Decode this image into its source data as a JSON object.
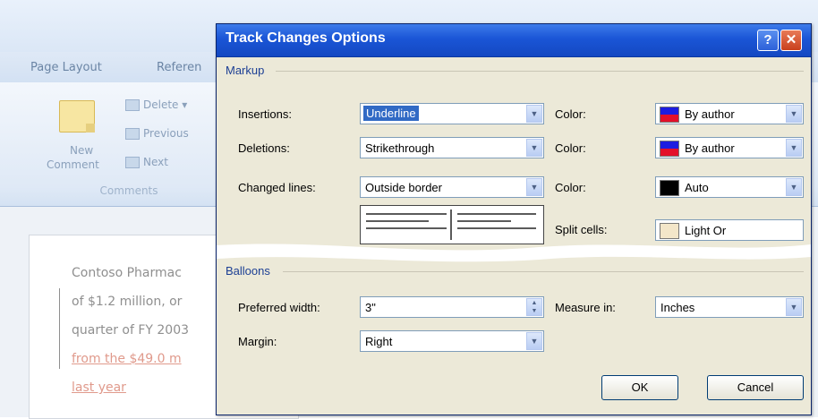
{
  "ribbon": {
    "tabs": [
      "Page Layout",
      "Referen"
    ],
    "new_comment_line1": "New",
    "new_comment_line2": "Comment",
    "delete_label": "Delete",
    "previous_label": "Previous",
    "next_label": "Next",
    "group_title": "Comments"
  },
  "document": {
    "lines": [
      "Contoso Pharmac",
      "of $1.2 million, or",
      "quarter of FY 2003",
      "from the $49.0 m",
      "last year"
    ]
  },
  "dialog": {
    "title": "Track Changes Options",
    "help_label": "?",
    "close_label": "✕",
    "markup": {
      "section_label": "Markup",
      "insertions_label": "Insertions:",
      "insertions_value": "Underline",
      "insertions_color_label": "Color:",
      "insertions_color_value": "By author",
      "deletions_label": "Deletions:",
      "deletions_value": "Strikethrough",
      "deletions_color_label": "Color:",
      "deletions_color_value": "By author",
      "changed_lines_label": "Changed lines:",
      "changed_lines_value": "Outside border",
      "changed_lines_color_label": "Color:",
      "changed_lines_color_value": "Auto",
      "split_cells_label": "Split cells:",
      "split_cells_value": "Light Or"
    },
    "balloons": {
      "section_label": "Balloons",
      "preferred_width_label": "Preferred width:",
      "preferred_width_value": "3\"",
      "measure_in_label": "Measure in:",
      "measure_in_value": "Inches",
      "margin_label": "Margin:",
      "margin_value": "Right"
    },
    "ok_label": "OK",
    "cancel_label": "Cancel"
  },
  "colors": {
    "title_bar": "#1a55d6",
    "dialog_bg": "#ece9d8",
    "section_label": "#1c3f94",
    "selection": "#316ac5"
  }
}
